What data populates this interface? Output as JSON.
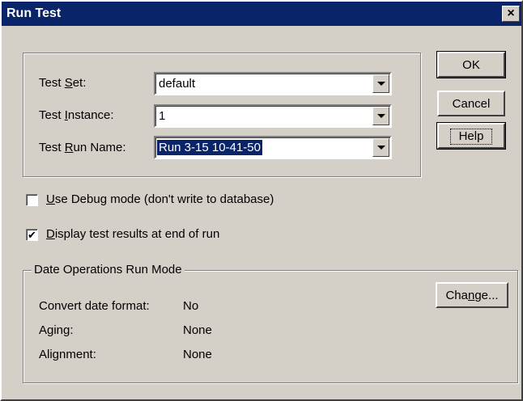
{
  "window": {
    "title": "Run Test",
    "close_glyph": "×"
  },
  "run_params": {
    "test_set": {
      "label_pre": "Test ",
      "label_accel": "S",
      "label_post": "et:",
      "value": "default"
    },
    "test_instance": {
      "label_pre": "Test ",
      "label_accel": "I",
      "label_post": "nstance:",
      "value": "1"
    },
    "test_run_name": {
      "label_pre": "Test ",
      "label_accel": "R",
      "label_post": "un Name:",
      "value": "Run 3-15 10-41-50"
    }
  },
  "buttons": {
    "ok": "OK",
    "cancel": "Cancel",
    "help": "Help",
    "change_pre": "Cha",
    "change_accel": "n",
    "change_post": "ge..."
  },
  "options": {
    "debug": {
      "accel": "U",
      "rest": "se Debug mode (don't write to database)",
      "checked": false
    },
    "display": {
      "accel": "D",
      "rest": "isplay test results at end of run",
      "checked": true,
      "check_glyph": "✔"
    }
  },
  "date_ops": {
    "legend": "Date Operations Run Mode",
    "convert_label": "Convert date format:",
    "convert_value": "No",
    "aging_label": "Aging:",
    "aging_value": "None",
    "alignment_label": "Alignment:",
    "alignment_value": "None"
  }
}
